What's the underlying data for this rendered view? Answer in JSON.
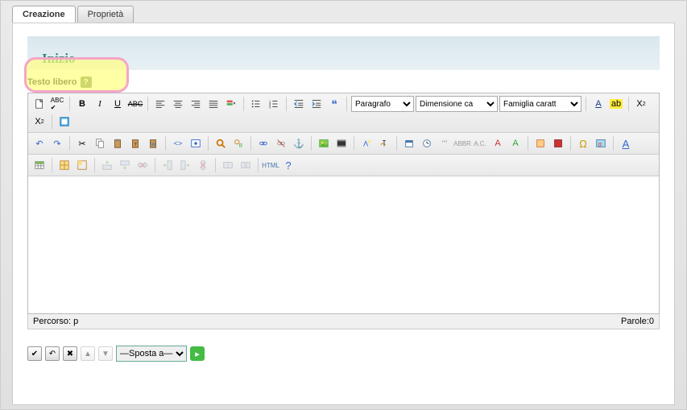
{
  "tabs": {
    "creation": "Creazione",
    "properties": "Proprietà"
  },
  "banner": {
    "title": "Inizio"
  },
  "field": {
    "label": "Testo libero",
    "help": "?"
  },
  "toolbar": {
    "format_select": "Paragrafo",
    "fontsize_select": "Dimensione ca",
    "fontfamily_select": "Famiglia caratt",
    "html_label": "HTML"
  },
  "status": {
    "path_label": "Percorso: p",
    "words_label": "Parole:0"
  },
  "footer": {
    "move_select": "—Sposta a—"
  }
}
